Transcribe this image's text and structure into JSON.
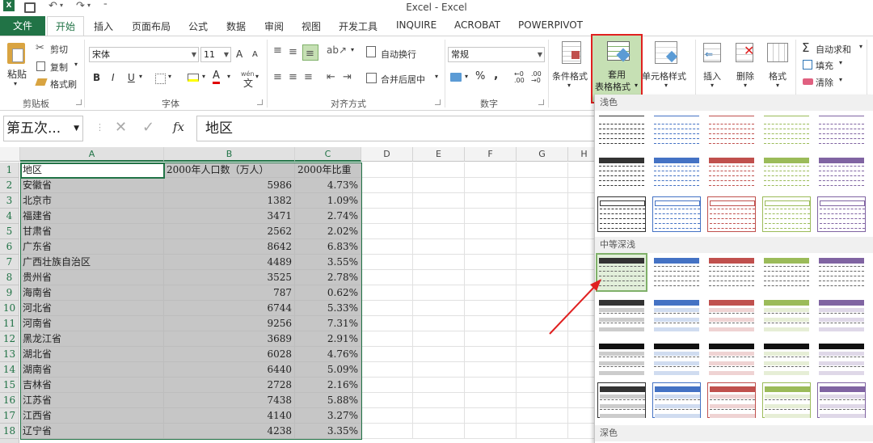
{
  "window": {
    "title": "Excel - Excel"
  },
  "qat": {
    "undo": "↶",
    "redo": "↷"
  },
  "tabs": [
    "文件",
    "开始",
    "插入",
    "页面布局",
    "公式",
    "数据",
    "审阅",
    "视图",
    "开发工具",
    "INQUIRE",
    "ACROBAT",
    "POWERPIVOT"
  ],
  "clipboard": {
    "paste": "粘贴",
    "cut": "剪切",
    "copy": "复制",
    "format_painter": "格式刷",
    "group": "剪贴板"
  },
  "font": {
    "name": "宋体",
    "size": "11",
    "bold": "B",
    "italic": "I",
    "underline": "U",
    "increase": "A",
    "decrease": "A",
    "group": "字体",
    "wen": "wén"
  },
  "alignment": {
    "wrap": "自动换行",
    "merge": "合并后居中",
    "group": "对齐方式"
  },
  "number": {
    "format": "常规",
    "percent": "%",
    "comma": ",",
    "group": "数字"
  },
  "styles": {
    "conditional": "条件格式",
    "table_line1": "套用",
    "table_line2": "表格格式",
    "cell_styles": "单元格样式"
  },
  "cells": {
    "insert": "插入",
    "delete": "删除",
    "format": "格式"
  },
  "editing": {
    "autosum": "自动求和",
    "fill": "填充",
    "clear": "清除",
    "autosum_icon": "Σ"
  },
  "formula_bar": {
    "name_box": "第五次...",
    "fx": "fx",
    "content": "地区"
  },
  "columns": [
    "A",
    "B",
    "C",
    "D",
    "E",
    "F",
    "G",
    "H"
  ],
  "rows": [
    {
      "n": "1",
      "a": "地区",
      "b": "2000年人口数（万人）",
      "c": "2000年比重"
    },
    {
      "n": "2",
      "a": "安徽省",
      "b": "5986",
      "c": "4.73%"
    },
    {
      "n": "3",
      "a": "北京市",
      "b": "1382",
      "c": "1.09%"
    },
    {
      "n": "4",
      "a": "福建省",
      "b": "3471",
      "c": "2.74%"
    },
    {
      "n": "5",
      "a": "甘肃省",
      "b": "2562",
      "c": "2.02%"
    },
    {
      "n": "6",
      "a": "广东省",
      "b": "8642",
      "c": "6.83%"
    },
    {
      "n": "7",
      "a": "广西壮族自治区",
      "b": "4489",
      "c": "3.55%"
    },
    {
      "n": "8",
      "a": "贵州省",
      "b": "3525",
      "c": "2.78%"
    },
    {
      "n": "9",
      "a": "海南省",
      "b": "787",
      "c": "0.62%"
    },
    {
      "n": "10",
      "a": "河北省",
      "b": "6744",
      "c": "5.33%"
    },
    {
      "n": "11",
      "a": "河南省",
      "b": "9256",
      "c": "7.31%"
    },
    {
      "n": "12",
      "a": "黑龙江省",
      "b": "3689",
      "c": "2.91%"
    },
    {
      "n": "13",
      "a": "湖北省",
      "b": "6028",
      "c": "4.76%"
    },
    {
      "n": "14",
      "a": "湖南省",
      "b": "6440",
      "c": "5.09%"
    },
    {
      "n": "15",
      "a": "吉林省",
      "b": "2728",
      "c": "2.16%"
    },
    {
      "n": "16",
      "a": "江苏省",
      "b": "7438",
      "c": "5.88%"
    },
    {
      "n": "17",
      "a": "江西省",
      "b": "4140",
      "c": "3.27%"
    },
    {
      "n": "18",
      "a": "辽宁省",
      "b": "4238",
      "c": "3.35%"
    }
  ],
  "gallery": {
    "light": "浅色",
    "medium": "中等深浅",
    "dark": "深色",
    "colors": [
      "#333333",
      "#4472c4",
      "#c0504d",
      "#9bbb59",
      "#8064a2"
    ]
  }
}
